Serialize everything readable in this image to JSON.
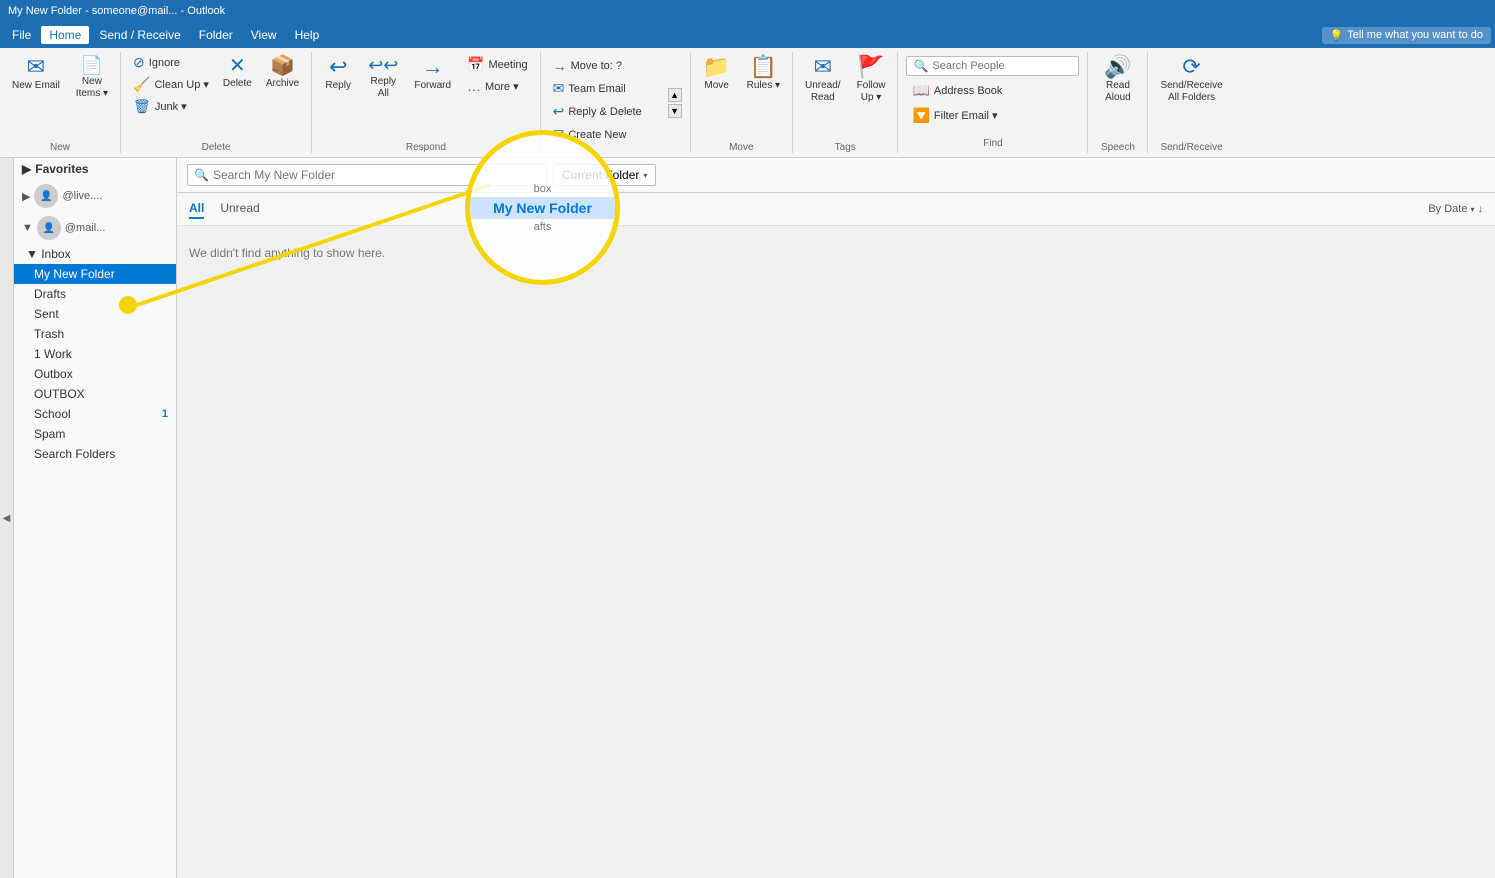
{
  "titleBar": {
    "title": "My New Folder - someone@mail... - Outlook"
  },
  "menuBar": {
    "items": [
      "File",
      "Home",
      "Send / Receive",
      "Folder",
      "View",
      "Help"
    ],
    "activeItem": "Home",
    "tellMe": "Tell me what you want to do"
  },
  "ribbon": {
    "groups": [
      {
        "label": "New",
        "buttons": [
          {
            "id": "new-email",
            "icon": "✉",
            "label": "New\nEmail"
          },
          {
            "id": "new-items",
            "icon": "📄",
            "label": "New\nItems ▾"
          }
        ]
      },
      {
        "label": "Delete",
        "buttons": [
          {
            "id": "ignore",
            "icon": "⊘",
            "label": "Ignore"
          },
          {
            "id": "clean-up",
            "icon": "🧹",
            "label": "Clean Up ▾"
          },
          {
            "id": "junk",
            "icon": "🗑",
            "label": "Junk ▾"
          },
          {
            "id": "delete",
            "icon": "✕",
            "label": "Delete"
          },
          {
            "id": "archive",
            "icon": "📦",
            "label": "Archive"
          }
        ]
      },
      {
        "label": "Respond",
        "buttons": [
          {
            "id": "reply",
            "icon": "↩",
            "label": "Reply"
          },
          {
            "id": "reply-all",
            "icon": "↩↩",
            "label": "Reply\nAll"
          },
          {
            "id": "forward",
            "icon": "→",
            "label": "Forward"
          },
          {
            "id": "meeting",
            "icon": "📅",
            "label": "Meeting"
          },
          {
            "id": "more",
            "icon": "…",
            "label": "More ▾"
          }
        ]
      },
      {
        "label": "",
        "stacked": [
          {
            "id": "move-to",
            "icon": "→",
            "label": "Move to: ?"
          },
          {
            "id": "team-email",
            "icon": "✉",
            "label": "Team Email"
          },
          {
            "id": "reply-delete",
            "icon": "↩",
            "label": "Reply & Delete"
          },
          {
            "id": "create-new",
            "icon": "✉+",
            "label": "Create New"
          }
        ],
        "scroll": true
      },
      {
        "label": "Move",
        "buttons": [
          {
            "id": "move",
            "icon": "📁",
            "label": "Move"
          },
          {
            "id": "rules",
            "icon": "📋",
            "label": "Rules ▾"
          }
        ]
      },
      {
        "label": "Tags",
        "buttons": [
          {
            "id": "unread-read",
            "icon": "✉",
            "label": "Unread/\nRead"
          },
          {
            "id": "follow-up",
            "icon": "🚩",
            "label": "Follow\nUp ▾"
          }
        ]
      },
      {
        "label": "Find",
        "searchPeople": {
          "placeholder": "Search People"
        },
        "addressBook": "Address Book",
        "filterEmail": "Filter Email ▾"
      },
      {
        "label": "Speech",
        "buttons": [
          {
            "id": "read-aloud",
            "icon": "🔊",
            "label": "Read\nAloud"
          }
        ]
      },
      {
        "label": "Send/Receive",
        "buttons": [
          {
            "id": "send-receive-all",
            "icon": "⟳",
            "label": "Send/Receive\nAll Folders"
          }
        ]
      }
    ]
  },
  "sidebar": {
    "favorites": {
      "label": "▶ Favorites"
    },
    "accounts": [
      {
        "id": "account1",
        "email": "@live....",
        "expanded": false
      },
      {
        "id": "account2",
        "email": "@mail...",
        "expanded": true
      }
    ],
    "folders": {
      "inbox": "Inbox",
      "myNewFolder": "My New Folder",
      "drafts": "Drafts",
      "sent": "Sent",
      "trash": "Trash",
      "work": "1 Work",
      "outbox": "Outbox",
      "outbox2": "OUTBOX",
      "school": "School",
      "schoolBadge": "1",
      "spam": "Spam",
      "searchFolders": "Search Folders"
    }
  },
  "emailList": {
    "searchPlaceholder": "Search My New Folder",
    "scopeLabel": "Current Folder",
    "tabs": [
      "All",
      "Unread"
    ],
    "activeTab": "All",
    "sortLabel": "By Date",
    "emptyMessage": "We didn't find anything to show here."
  },
  "annotation": {
    "circleText": "My New Folder",
    "highlightedFolderAbove": "box",
    "highlightedFolderBelow": "afts"
  },
  "colors": {
    "accent": "#0078d4",
    "ribbonBg": "#1e6eb4",
    "activeFolderBg": "#0078d4",
    "yellow": "#f5d400"
  }
}
